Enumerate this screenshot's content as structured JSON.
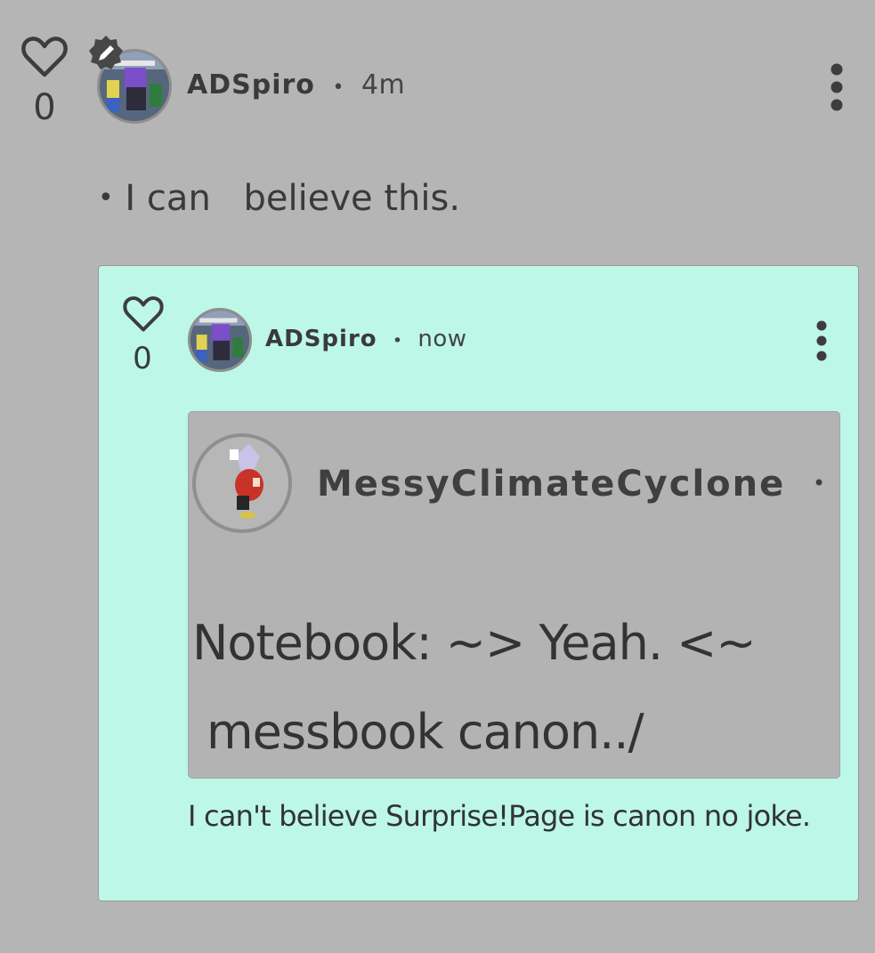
{
  "post": {
    "like_count": "0",
    "username": "ADSpiro",
    "separator": "•",
    "time": "4m",
    "body_bullet": "•",
    "body_part1": "I can",
    "body_part2": "believe this.",
    "icons": {
      "like": "heart-icon",
      "badge": "pencil-edit-icon",
      "menu": "vertical-dots-icon"
    }
  },
  "reply": {
    "like_count": "0",
    "username": "ADSpiro",
    "separator": "•",
    "time": "now",
    "quoted": {
      "username": "MessyClimateCyclone",
      "separator": "•",
      "line1": "Notebook: ~> Yeah. <~",
      "line2": "messbook canon../"
    },
    "text": "I can't believe Surprise!Page is canon no joke."
  },
  "colors": {
    "page_background": "#b5b5b5",
    "reply_background": "#bdf7e8",
    "quoted_background": "#b3b3b3",
    "text": "#333333"
  }
}
